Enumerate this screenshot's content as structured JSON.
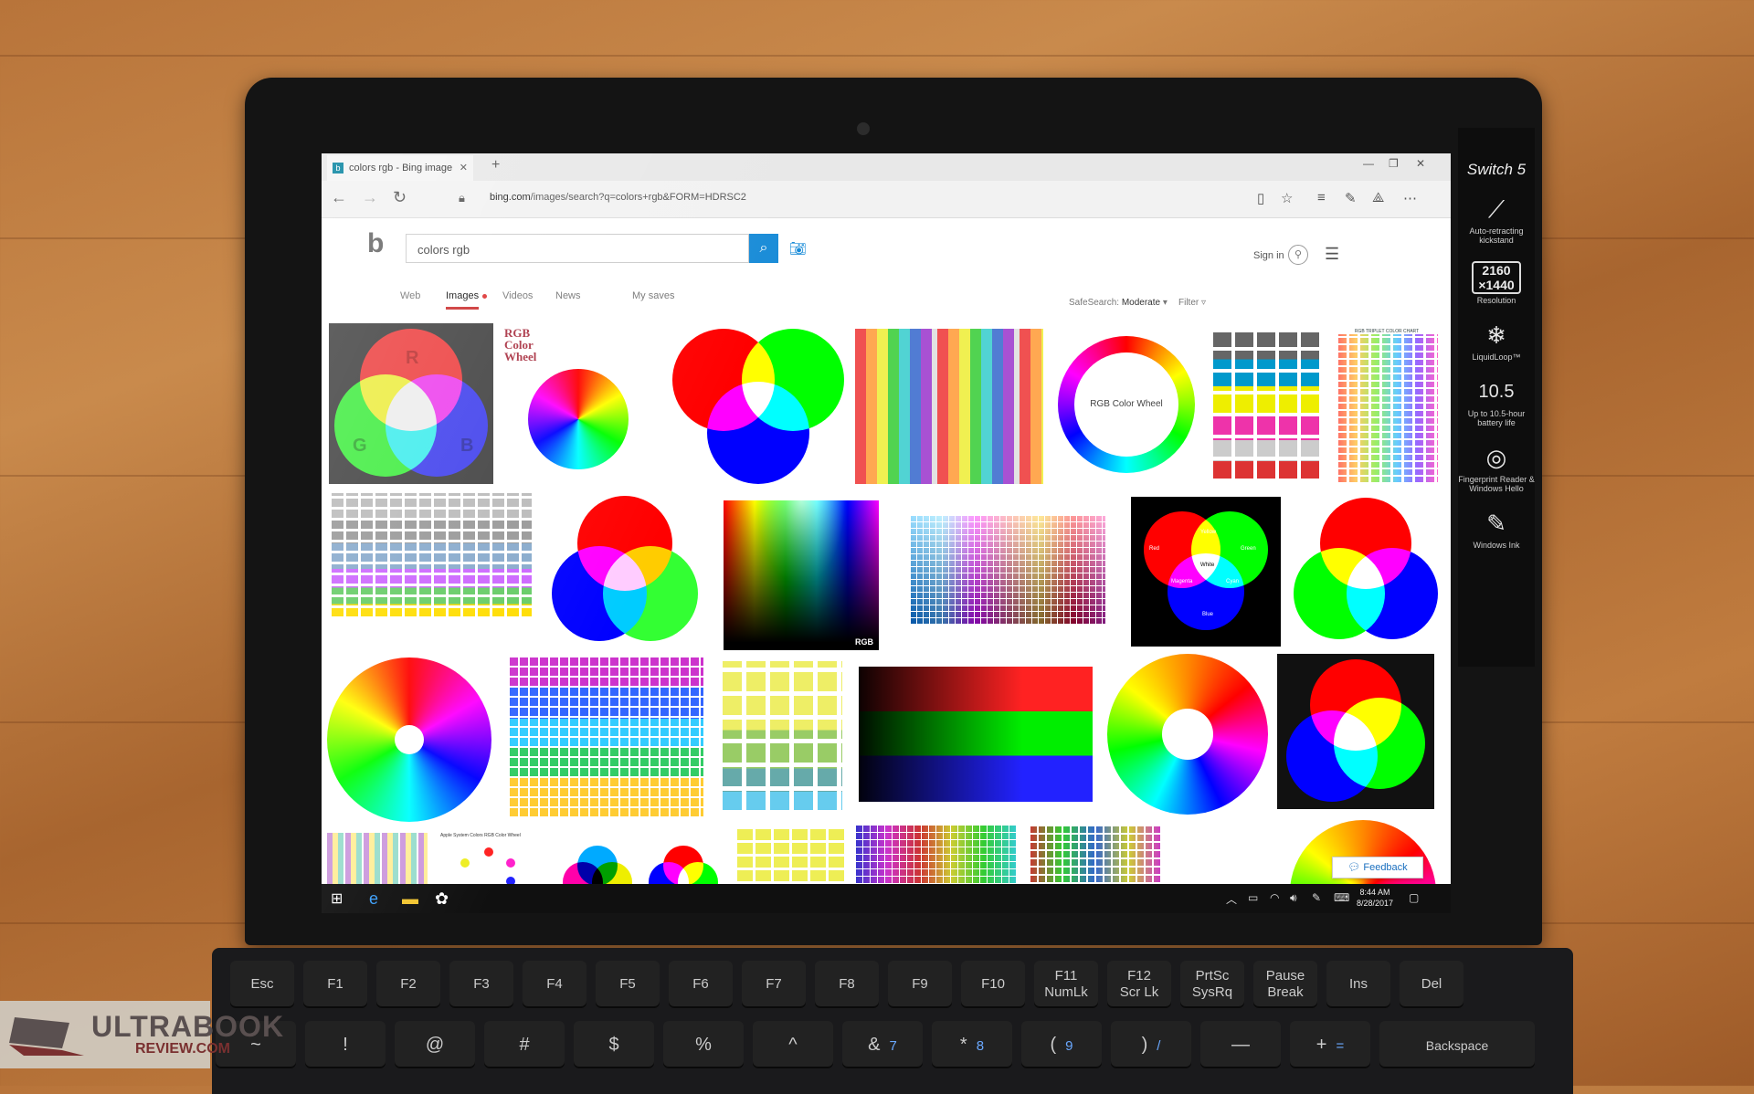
{
  "device": {
    "brand_label": "Switch 5",
    "features": [
      {
        "icon": "kickstand-icon",
        "label": "Auto-retracting kickstand"
      },
      {
        "icon": "resolution-icon",
        "label": "Resolution",
        "text": "2160\n×1440"
      },
      {
        "icon": "cpu-cooling-icon",
        "label": "LiquidLoop™"
      },
      {
        "icon": "battery-icon",
        "label": "Up to 10.5-hour battery life",
        "text": "10.5"
      },
      {
        "icon": "fingerprint-icon",
        "label": "Fingerprint Reader & Windows Hello"
      },
      {
        "icon": "pen-icon",
        "label": "Windows Ink"
      }
    ]
  },
  "browser": {
    "tab_title": "colors rgb - Bing image",
    "url_host": "bing.com",
    "url_path": "/images/search?q=colors+rgb&FORM=HDRSC2"
  },
  "bing": {
    "query": "colors rgb",
    "sign_in": "Sign in",
    "tabs": [
      "Web",
      "Images",
      "Videos",
      "News",
      "My saves"
    ],
    "active_tab": "Images",
    "safesearch_label": "SafeSearch:",
    "safesearch_value": "Moderate",
    "filter_label": "Filter",
    "feedback": "Feedback",
    "image_texts": {
      "r": "R",
      "g": "G",
      "b": "B",
      "rgb_wheel_title": "RGB Color Wheel",
      "ring_label": "RGB Color Wheel",
      "rgb_corner": "RGB",
      "venn_red": "Red",
      "venn_yellow": "Yellow",
      "venn_green": "Green",
      "venn_magenta": "Magenta",
      "venn_white": "White",
      "venn_cyan": "Cyan",
      "venn_blue": "Blue",
      "chart_title": "RGB TRIPLET COLOR CHART",
      "apple_title": "Apple System Colors RGB Color Wheel"
    }
  },
  "taskbar": {
    "time": "8:44 AM",
    "date": "8/28/2017"
  },
  "keyboard": {
    "fn_row": [
      "Esc",
      "F1",
      "F2",
      "F3",
      "F4",
      "F5",
      "F6",
      "F7",
      "F8",
      "F9",
      "F10",
      "F11\nNumLk",
      "F12\nScr Lk",
      "PrtSc\nSysRq",
      "Pause\nBreak",
      "Ins",
      "Del"
    ],
    "num_row": [
      "~",
      "!",
      "@",
      "#",
      "$",
      "%",
      "^",
      "&",
      "*",
      "(",
      ")",
      "—",
      "+",
      "Backspace"
    ],
    "num_row_sub": [
      "",
      "",
      "",
      "",
      "",
      "",
      "",
      "7",
      "8",
      "9",
      "/",
      "",
      "=",
      ""
    ]
  },
  "watermark": {
    "line1": "ULTRABOOK",
    "line2": "REVIEW.COM"
  }
}
